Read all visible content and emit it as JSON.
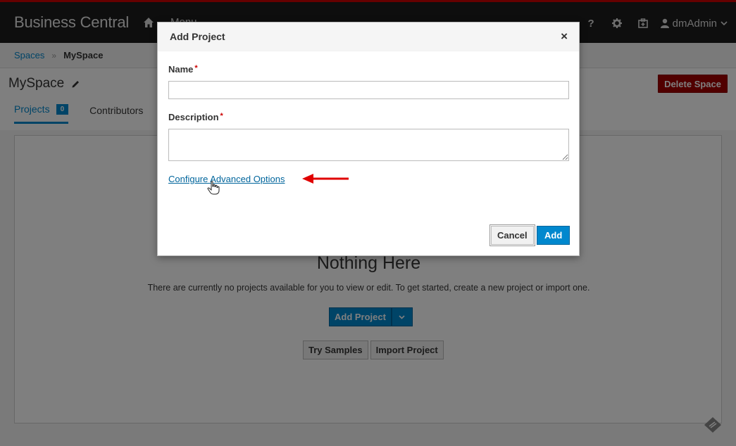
{
  "header": {
    "brand": "Business Central",
    "menu_label": "Menu",
    "help_label": "?",
    "user_name": "dmAdmin"
  },
  "breadcrumb": {
    "spaces": "Spaces",
    "current": "MySpace"
  },
  "page": {
    "title": "MySpace",
    "delete_label": "Delete Space",
    "tabs": [
      {
        "label": "Projects",
        "count": "0"
      },
      {
        "label": "Contributors"
      }
    ]
  },
  "empty_state": {
    "title": "Nothing Here",
    "text": "There are currently no projects available for you to view or edit. To get started, create a new project or import one.",
    "add_project_label": "Add Project",
    "try_samples_label": "Try Samples",
    "import_project_label": "Import Project"
  },
  "modal": {
    "title": "Add Project",
    "close_label": "×",
    "name_label": "Name",
    "name_value": "",
    "description_label": "Description",
    "description_value": "",
    "required_marker": "*",
    "advanced_link": "Configure Advanced Options",
    "cancel_label": "Cancel",
    "add_label": "Add"
  },
  "colors": {
    "accent": "#0088ce",
    "danger": "#a30000",
    "annotation_arrow": "#e00000"
  }
}
